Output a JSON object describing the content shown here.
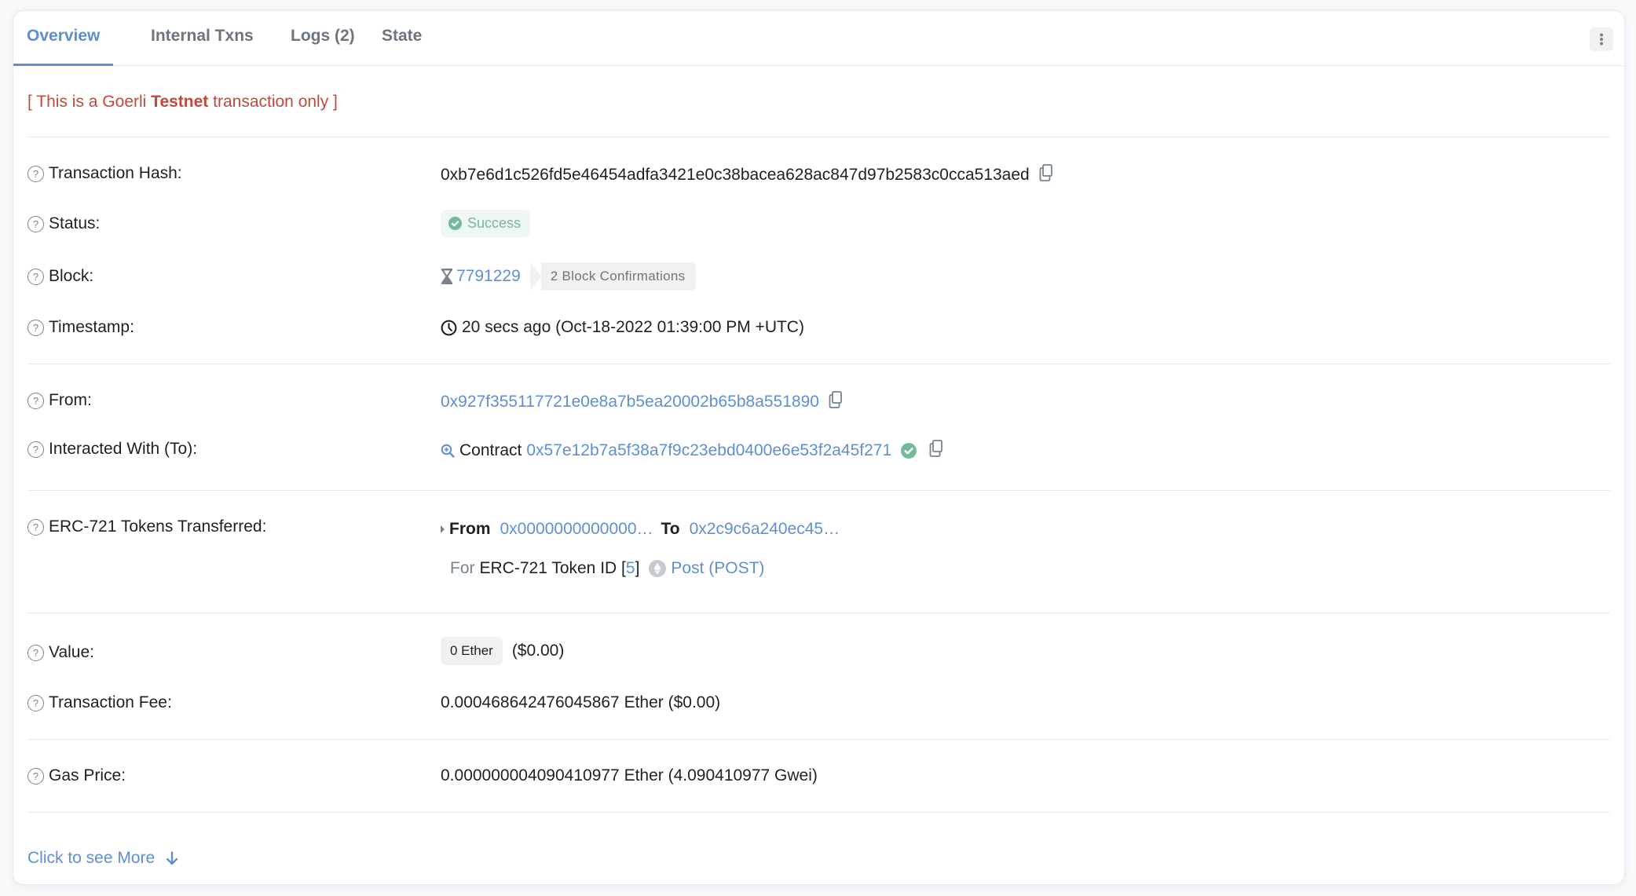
{
  "tabs": [
    {
      "label": "Overview",
      "active": true
    },
    {
      "label": "Internal Txns",
      "active": false
    },
    {
      "label": "Logs (2)",
      "active": false
    },
    {
      "label": "State",
      "active": false
    }
  ],
  "notice": {
    "prefix": "[ This is a Goerli ",
    "bold": "Testnet",
    "suffix": " transaction only ]"
  },
  "fields": {
    "hash": {
      "label": "Transaction Hash:",
      "value": "0xb7e6d1c526fd5e46454adfa3421e0c38bacea628ac847d97b2583c0cca513aed"
    },
    "status": {
      "label": "Status:",
      "value": "Success"
    },
    "block": {
      "label": "Block:",
      "value": "7791229",
      "confirmations": "2 Block Confirmations"
    },
    "timestamp": {
      "label": "Timestamp:",
      "value": "20 secs ago (Oct-18-2022 01:39:00 PM +UTC)"
    },
    "from": {
      "label": "From:",
      "value": "0x927f355117721e0e8a7b5ea20002b65b8a551890"
    },
    "to": {
      "label": "Interacted With (To):",
      "prefix": "Contract",
      "value": "0x57e12b7a5f38a7f9c23ebd0400e6e53f2a45f271"
    },
    "erc721": {
      "label": "ERC-721 Tokens Transferred:",
      "from_label": "From",
      "from_value": "0x0000000000000…",
      "to_label": "To",
      "to_value": "0x2c9c6a240ec45…",
      "for_label": "For",
      "token_text": "ERC-721 Token ID [",
      "token_id": "5",
      "token_close": "]",
      "token_name": "Post (POST)"
    },
    "value": {
      "label": "Value:",
      "badge": "0 Ether",
      "usd": "($0.00)"
    },
    "fee": {
      "label": "Transaction Fee:",
      "value": "0.000468642476045867 Ether ($0.00)"
    },
    "gas": {
      "label": "Gas Price:",
      "value": "0.000000004090410977 Ether (4.090410977 Gwei)"
    }
  },
  "see_more": "Click to see More",
  "colors": {
    "accent": "#5f8fd2",
    "success": "#76b99a",
    "testnet": "#c4483a"
  }
}
